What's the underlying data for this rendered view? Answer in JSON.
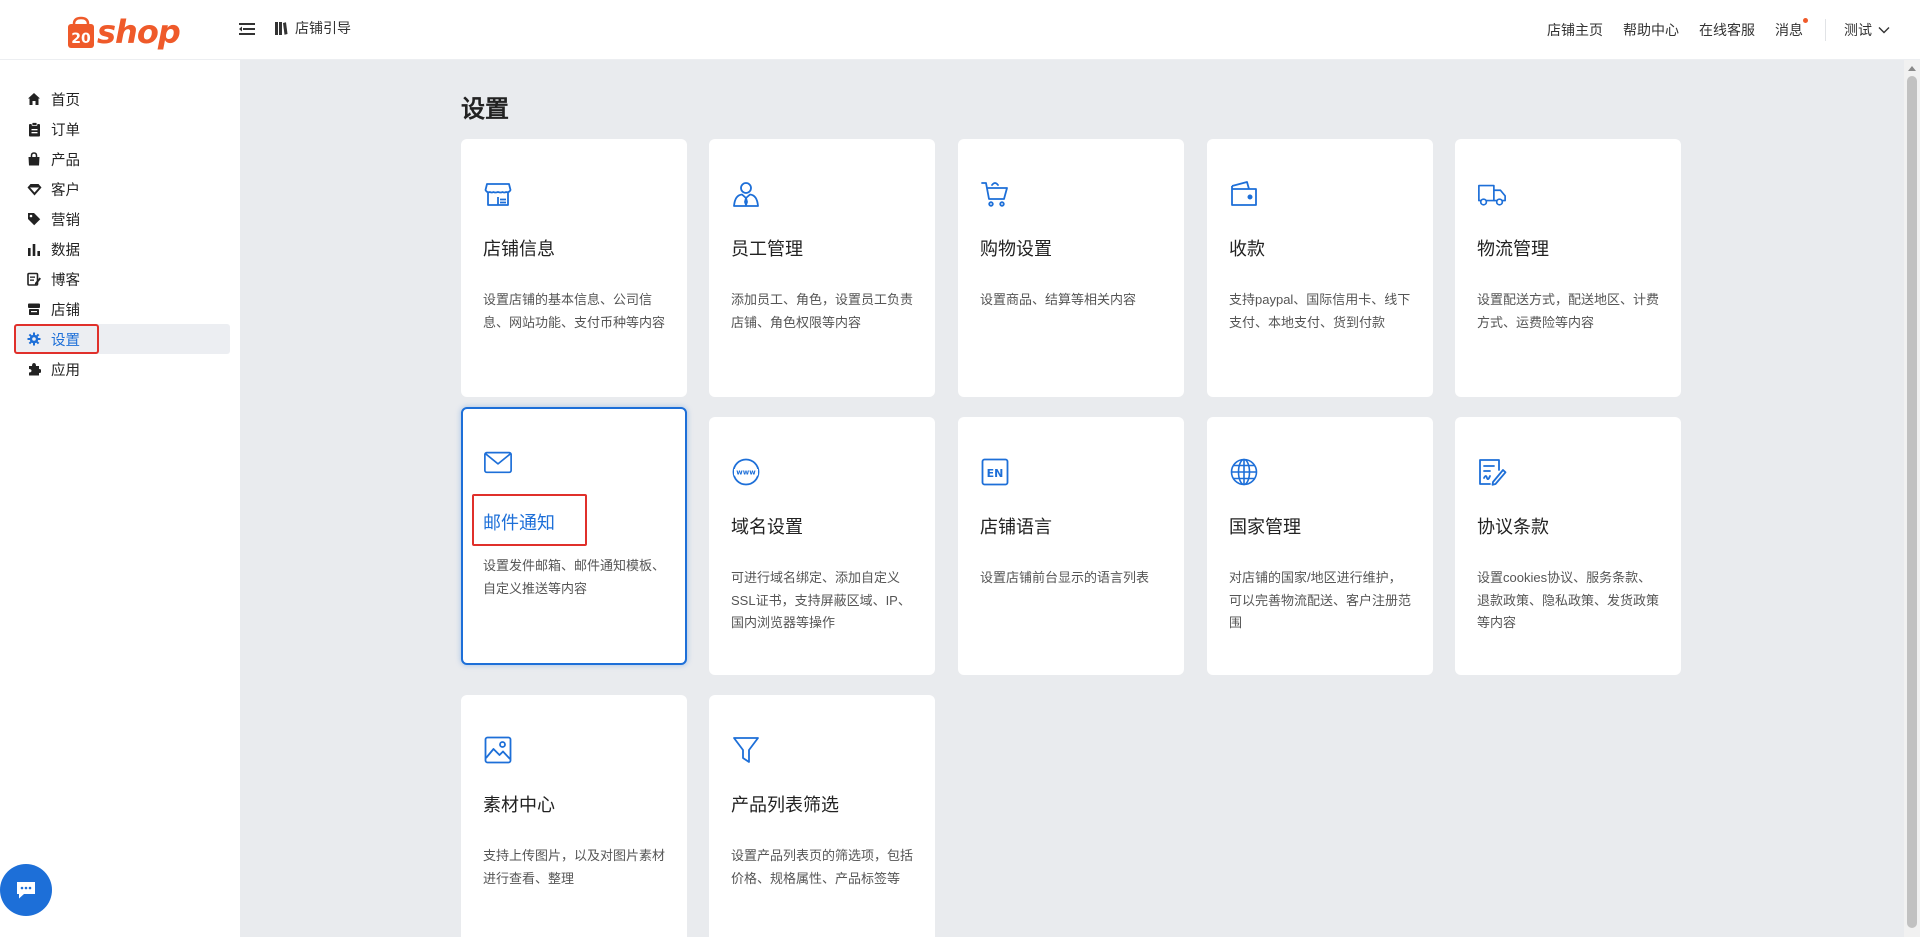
{
  "header": {
    "logo_text": "shop",
    "logo_mark": "20",
    "guide_label": "店铺引导",
    "links": [
      "店铺主页",
      "帮助中心",
      "在线客服",
      "消息"
    ],
    "user_label": "测试"
  },
  "sidebar": {
    "items": [
      {
        "label": "首页",
        "icon": "home-icon"
      },
      {
        "label": "订单",
        "icon": "clipboard-icon"
      },
      {
        "label": "产品",
        "icon": "shopping-bag-icon"
      },
      {
        "label": "客户",
        "icon": "gem-icon"
      },
      {
        "label": "营销",
        "icon": "tag-icon"
      },
      {
        "label": "数据",
        "icon": "bar-chart-icon"
      },
      {
        "label": "博客",
        "icon": "edit-icon"
      },
      {
        "label": "店铺",
        "icon": "store-icon"
      },
      {
        "label": "设置",
        "icon": "gear-icon"
      },
      {
        "label": "应用",
        "icon": "puzzle-icon"
      }
    ],
    "active_index": 8
  },
  "main": {
    "title": "设置",
    "cards": [
      {
        "title": "店铺信息",
        "desc": "设置店铺的基本信息、公司信息、网站功能、支付币种等内容",
        "icon": "shop-icon"
      },
      {
        "title": "员工管理",
        "desc": "添加员工、角色，设置员工负责店铺、角色权限等内容",
        "icon": "staff-icon"
      },
      {
        "title": "购物设置",
        "desc": "设置商品、结算等相关内容",
        "icon": "cart-icon"
      },
      {
        "title": "收款",
        "desc": "支持paypal、国际信用卡、线下支付、本地支付、货到付款",
        "icon": "wallet-icon"
      },
      {
        "title": "物流管理",
        "desc": "设置配送方式，配送地区、计费方式、运费险等内容",
        "icon": "truck-icon"
      },
      {
        "title": "邮件通知",
        "desc": "设置发件邮箱、邮件通知模板、自定义推送等内容",
        "icon": "mail-icon"
      },
      {
        "title": "域名设置",
        "desc": "可进行域名绑定、添加自定义SSL证书，支持屏蔽区域、IP、国内浏览器等操作",
        "icon": "www-icon"
      },
      {
        "title": "店铺语言",
        "desc": "设置店铺前台显示的语言列表",
        "icon": "language-en-icon"
      },
      {
        "title": "国家管理",
        "desc": "对店铺的国家/地区进行维护，可以完善物流配送、客户注册范围",
        "icon": "globe-icon"
      },
      {
        "title": "协议条款",
        "desc": "设置cookies协议、服务条款、退款政策、隐私政策、发货政策等内容",
        "icon": "document-sign-icon"
      },
      {
        "title": "素材中心",
        "desc": "支持上传图片，以及对图片素材进行查看、整理",
        "icon": "image-icon"
      },
      {
        "title": "产品列表筛选",
        "desc": "设置产品列表页的筛选项，包括价格、规格属性、产品标签等",
        "icon": "filter-icon"
      }
    ],
    "selected_index": 5
  },
  "colors": {
    "accent": "#1d6fd8",
    "brand": "#ef5a2a",
    "highlight": "#e0302b",
    "background": "#e9ebee"
  }
}
